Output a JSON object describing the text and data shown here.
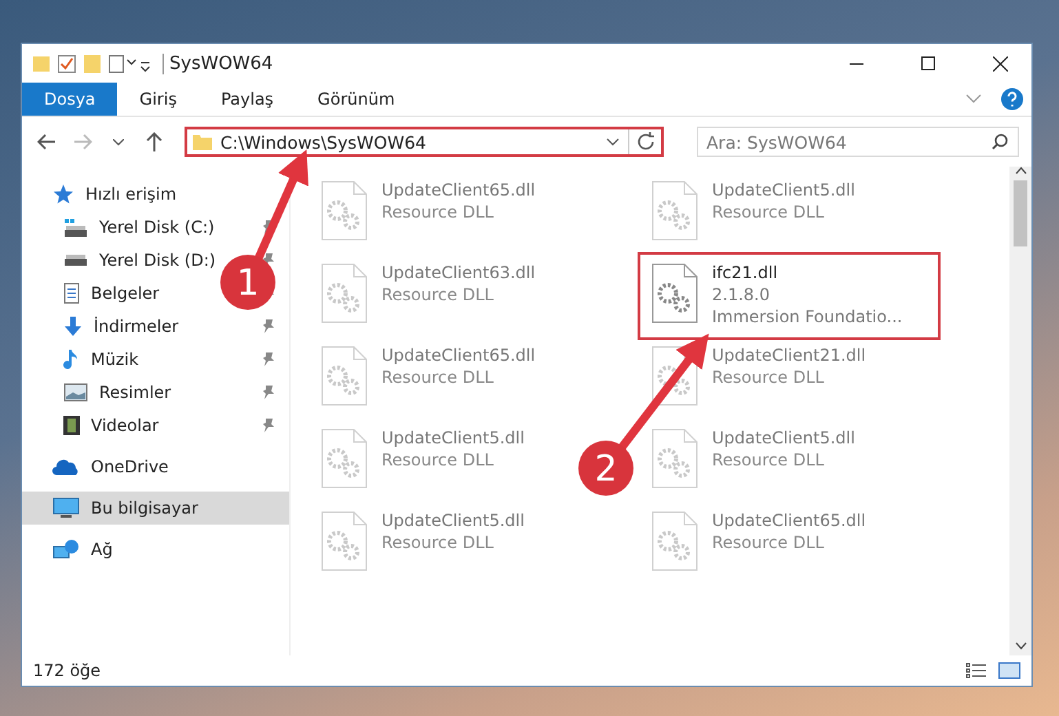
{
  "window": {
    "title": "SysWOW64"
  },
  "ribbon": {
    "tabs": [
      {
        "label": "Dosya",
        "selected": true
      },
      {
        "label": "Giriş",
        "selected": false
      },
      {
        "label": "Paylaş",
        "selected": false
      },
      {
        "label": "Görünüm",
        "selected": false
      }
    ]
  },
  "address_bar": {
    "path": "C:\\Windows\\SysWOW64",
    "highlighted": true
  },
  "search": {
    "placeholder": "Ara: SysWOW64"
  },
  "sidebar": {
    "items": [
      {
        "label": "Hızlı erişim",
        "selected": false,
        "children": [
          {
            "label": "Yerel Disk (C:)",
            "pinned": true,
            "selected": false
          },
          {
            "label": "Yerel Disk (D:)",
            "pinned": true,
            "selected": false
          },
          {
            "label": "Belgeler",
            "pinned": true,
            "selected": false
          },
          {
            "label": "İndirmeler",
            "pinned": true,
            "selected": false
          },
          {
            "label": "Müzik",
            "pinned": true,
            "selected": false
          },
          {
            "label": "Resimler",
            "pinned": true,
            "selected": false
          },
          {
            "label": "Videolar",
            "pinned": true,
            "selected": false
          }
        ]
      },
      {
        "label": "OneDrive",
        "selected": false
      },
      {
        "label": "Bu bilgisayar",
        "selected": true
      },
      {
        "label": "Ağ",
        "selected": false
      }
    ]
  },
  "files": [
    {
      "name": "UpdateClient65.dll",
      "details": [
        "Resource DLL"
      ],
      "faded": true,
      "highlighted": false
    },
    {
      "name": "UpdateClient5.dll",
      "details": [
        "Resource DLL"
      ],
      "faded": true,
      "highlighted": false
    },
    {
      "name": "UpdateClient63.dll",
      "details": [
        "Resource DLL"
      ],
      "faded": true,
      "highlighted": false
    },
    {
      "name": "ifc21.dll",
      "details": [
        "2.1.8.0",
        "Immersion Foundatio..."
      ],
      "faded": false,
      "highlighted": true
    },
    {
      "name": "UpdateClient65.dll",
      "details": [
        "Resource DLL"
      ],
      "faded": true,
      "highlighted": false
    },
    {
      "name": "UpdateClient21.dll",
      "details": [
        "Resource DLL"
      ],
      "faded": true,
      "highlighted": false
    },
    {
      "name": "UpdateClient5.dll",
      "details": [
        "Resource DLL"
      ],
      "faded": true,
      "highlighted": false
    },
    {
      "name": "UpdateClient5.dll",
      "details": [
        "Resource DLL"
      ],
      "faded": true,
      "highlighted": false
    },
    {
      "name": "UpdateClient5.dll",
      "details": [
        "Resource DLL"
      ],
      "faded": true,
      "highlighted": false
    },
    {
      "name": "UpdateClient65.dll",
      "details": [
        "Resource DLL"
      ],
      "faded": true,
      "highlighted": false
    }
  ],
  "status_bar": {
    "item_count": "172 öğe"
  },
  "annotations": [
    {
      "number": "1"
    },
    {
      "number": "2"
    }
  ]
}
